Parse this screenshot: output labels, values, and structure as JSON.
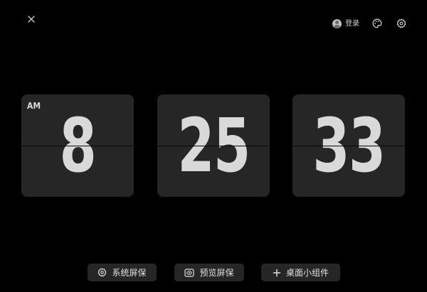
{
  "top_bar": {
    "close_icon": "close-icon",
    "login_label": "登录",
    "avatar_icon": "user-avatar-icon",
    "palette_icon": "palette-icon",
    "settings_icon": "gear-icon"
  },
  "clock": {
    "period": "AM",
    "hours": "8",
    "minutes": "25",
    "seconds": "33"
  },
  "bottom_buttons": [
    {
      "label": "系统屏保",
      "icon": "gear-icon"
    },
    {
      "label": "预览屏保",
      "icon": "eye-icon"
    },
    {
      "label": "桌面小组件",
      "icon": "plus-icon"
    }
  ],
  "colors": {
    "background": "#000000",
    "card": "#262626",
    "digits": "#d9d9d9"
  }
}
